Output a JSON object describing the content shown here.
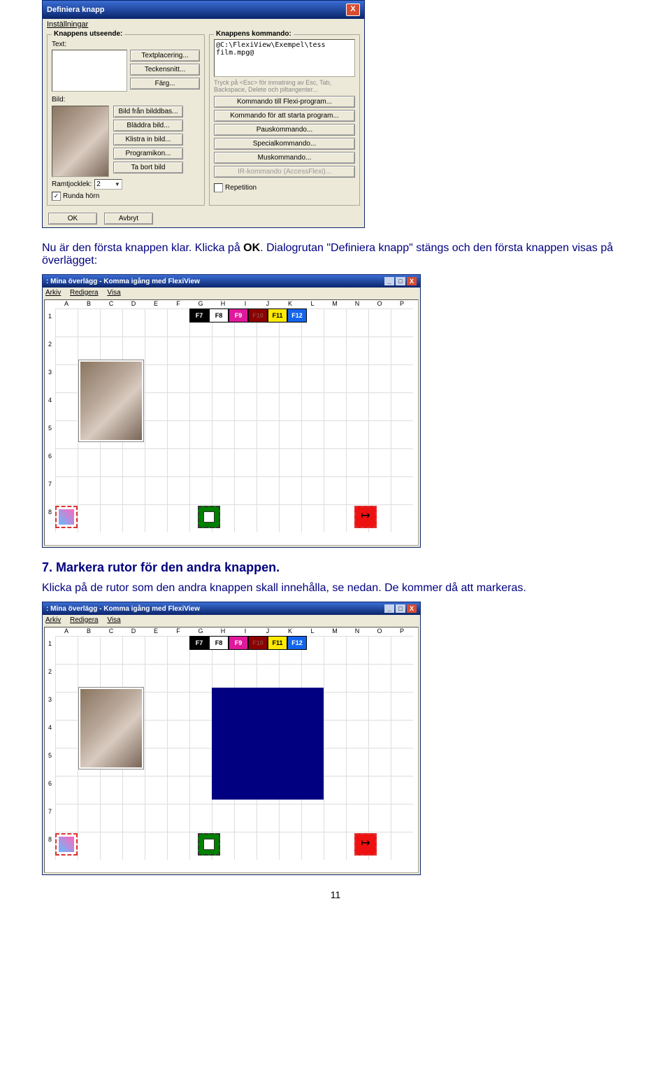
{
  "dialog": {
    "title": "Definiera knapp",
    "menu_settings": "Inställningar",
    "appearance_group": "Knappens utseende:",
    "command_group": "Knappens kommando:",
    "text_label": "Text:",
    "image_label": "Bild:",
    "btn_placement": "Textplacering...",
    "btn_font": "Teckensnitt...",
    "btn_color": "Färg...",
    "btn_from_db": "Bild från bilddbas...",
    "btn_browse": "Bläddra bild...",
    "btn_paste": "Klistra in bild...",
    "btn_progicon": "Programikon...",
    "btn_remove_img": "Ta bort bild",
    "border_label": "Ramtjocklek:",
    "border_value": "2",
    "round_corners": "Runda hörn",
    "command_text": "@C:\\FlexiView\\Exempel\\tess\nfilm.mpg@",
    "hint_text": "Tryck på <Esc> för inmatning av Esc, Tab, Backspace, Delete och piltangenter...",
    "btn_cmd_flexi": "Kommando till Flexi-program...",
    "btn_cmd_start": "Kommando för att starta program...",
    "btn_cmd_pause": "Pauskommando...",
    "btn_cmd_special": "Specialkommando...",
    "btn_cmd_mouse": "Muskommando...",
    "btn_cmd_ir": "IR-kommando (AccessFlexi)...",
    "chk_repeat": "Repetition",
    "ok": "OK",
    "cancel": "Avbryt"
  },
  "para1_a": "Nu är den första knappen klar. Klicka på ",
  "para1_b": "OK",
  "para1_c": ". Dialogrutan \"Definiera knapp\" stängs och den första knappen visas på överlägget:",
  "gridwin_title": ": Mina överlägg - Komma igång med FlexiView",
  "grid_menus": {
    "m1": "Arkiv",
    "m2": "Redigera",
    "m3": "Visa"
  },
  "cols": [
    "A",
    "B",
    "C",
    "D",
    "E",
    "F",
    "G",
    "H",
    "I",
    "J",
    "K",
    "L",
    "M",
    "N",
    "O",
    "P"
  ],
  "rows": [
    "1",
    "2",
    "3",
    "4",
    "5",
    "6",
    "7",
    "8"
  ],
  "fkeys": [
    "F7",
    "F8",
    "F9",
    "F10",
    "F11",
    "F12"
  ],
  "heading7": "7. Markera rutor för den andra knappen.",
  "para2_a": "Klicka på de rutor som den andra knappen skall innehålla, se nedan. De kommer då att markeras.",
  "page_number": "11"
}
